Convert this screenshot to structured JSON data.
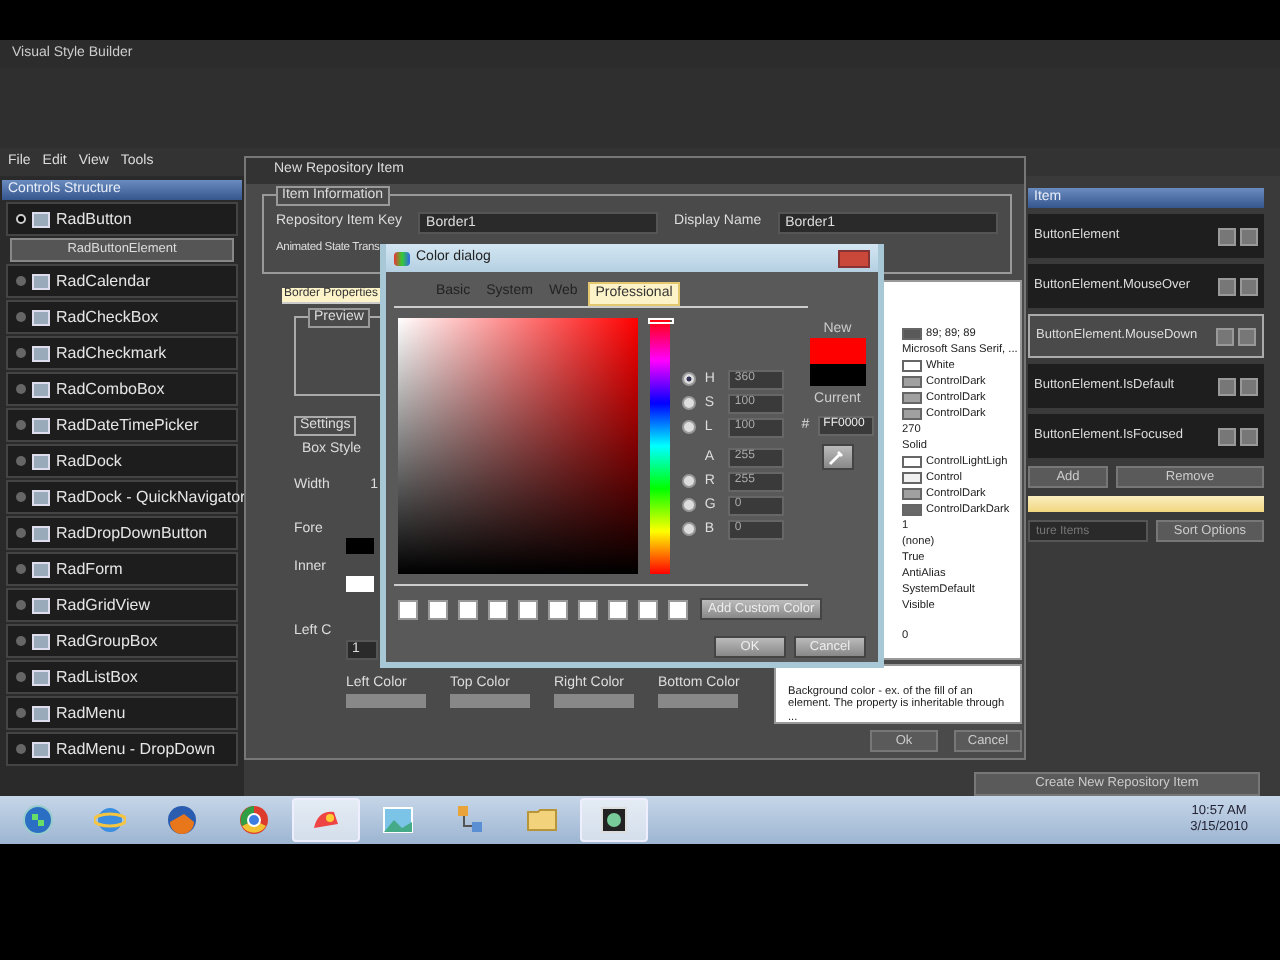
{
  "app": {
    "title": "Visual Style Builder",
    "menu": [
      "File",
      "Edit",
      "View",
      "Tools"
    ]
  },
  "controls_structure": {
    "title": "Controls Structure",
    "items": [
      {
        "label": "RadButton",
        "expanded": true,
        "children": [
          {
            "label": "RadButtonElement",
            "selected": true
          }
        ]
      },
      {
        "label": "RadCalendar",
        "expanded": false
      },
      {
        "label": "RadCheckBox",
        "expanded": false
      },
      {
        "label": "RadCheckmark",
        "expanded": false
      },
      {
        "label": "RadComboBox",
        "expanded": false
      },
      {
        "label": "RadDateTimePicker",
        "expanded": false
      },
      {
        "label": "RadDock",
        "expanded": false
      },
      {
        "label": "RadDock - QuickNavigator",
        "expanded": false
      },
      {
        "label": "RadDropDownButton",
        "expanded": false
      },
      {
        "label": "RadForm",
        "expanded": false
      },
      {
        "label": "RadGridView",
        "expanded": false
      },
      {
        "label": "RadGroupBox",
        "expanded": false
      },
      {
        "label": "RadListBox",
        "expanded": false
      },
      {
        "label": "RadMenu",
        "expanded": false
      },
      {
        "label": "RadMenu - DropDown",
        "expanded": false
      }
    ]
  },
  "states_panel": {
    "title": "Item",
    "items": [
      {
        "label": "ButtonElement",
        "selected": false
      },
      {
        "label": "ButtonElement.MouseOver",
        "selected": false
      },
      {
        "label": "ButtonElement.MouseDown",
        "selected": true
      },
      {
        "label": "ButtonElement.IsDefault",
        "selected": false
      },
      {
        "label": "ButtonElement.IsFocused",
        "selected": false
      }
    ],
    "add_button": "Add",
    "remove_button": "Remove",
    "filter": {
      "placeholder": "ture Items"
    },
    "sort_button": "Sort Options"
  },
  "create_button": "Create New Repository Item",
  "repository_dialog": {
    "title": "New Repository Item",
    "group": "Item Information",
    "key_label": "Repository Item Key",
    "key_value": "Border1",
    "name_label": "Display Name",
    "name_value": "Border1",
    "animated_label": "Animated State Trans",
    "tabs": [
      {
        "label": "Border Properties",
        "selected": true
      }
    ],
    "preview_label": "Preview",
    "settings_label": "Settings",
    "box_style_label": "Box Style",
    "width_label": "Width",
    "width_value": "1",
    "fore_label": "Fore",
    "inner_label": "Inner",
    "left_label": "Left C",
    "left_value": "1",
    "edge_colors": [
      "Left Color",
      "Top Color",
      "Right Color",
      "Bottom Color"
    ],
    "properties": [
      {
        "value": "89; 89; 89",
        "color": "#595959"
      },
      {
        "value": "Microsoft Sans Serif, ..."
      },
      {
        "value": "White",
        "color": "#ffffff"
      },
      {
        "value": "ControlDark",
        "color": "#a0a0a0"
      },
      {
        "value": "ControlDark",
        "color": "#a0a0a0"
      },
      {
        "value": "ControlDark",
        "color": "#a0a0a0"
      },
      {
        "value": "270"
      },
      {
        "value": "Solid"
      },
      {
        "value": "ControlLightLigh",
        "color": "#ffffff"
      },
      {
        "value": "Control",
        "color": "#f0f0f0"
      },
      {
        "value": "ControlDark",
        "color": "#a0a0a0"
      },
      {
        "value": "ControlDarkDark",
        "color": "#696969"
      },
      {
        "value": "1"
      },
      {
        "value": "(none)"
      },
      {
        "value": "True"
      },
      {
        "value": "AntiAlias"
      },
      {
        "value": "SystemDefault"
      },
      {
        "value": "Visible"
      },
      {
        "value": "0"
      }
    ],
    "description": "Background color - ex. of the fill of an element. The property is inheritable through ...",
    "buttons": [
      "Ok",
      "Cancel"
    ]
  },
  "color_dialog": {
    "title": "Color dialog",
    "tabs": [
      {
        "label": "Basic",
        "selected": false
      },
      {
        "label": "System",
        "selected": false
      },
      {
        "label": "Web",
        "selected": false
      },
      {
        "label": "Professional",
        "selected": true
      }
    ],
    "hsl": [
      {
        "label": "H",
        "value": "360",
        "selected": true
      },
      {
        "label": "S",
        "value": "100",
        "selected": false
      },
      {
        "label": "L",
        "value": "100",
        "selected": false
      }
    ],
    "alpha": {
      "label": "A",
      "value": "255"
    },
    "rgb": [
      {
        "label": "R",
        "value": "255",
        "selected": false
      },
      {
        "label": "G",
        "value": "0",
        "selected": false
      },
      {
        "label": "B",
        "value": "0",
        "selected": false
      }
    ],
    "hue_slider": {
      "level": 1
    },
    "new_label": "New",
    "current_label": "Current",
    "hex_label": "#",
    "hex_value": "FF0000",
    "add_custom_button": "Add Custom Color",
    "ok_button": "OK",
    "cancel_button": "Cancel"
  },
  "taskbar": {
    "apps": [
      {
        "kind": "orb",
        "selected": false
      },
      {
        "kind": "globe",
        "selected": false
      },
      {
        "kind": "fox",
        "selected": false
      },
      {
        "kind": "wheel",
        "selected": false
      },
      {
        "kind": "paint",
        "selected": true
      },
      {
        "kind": "picture",
        "selected": false
      },
      {
        "kind": "network",
        "selected": false
      },
      {
        "kind": "folder",
        "selected": false
      },
      {
        "kind": "app",
        "selected": true
      }
    ],
    "time": "10:57 AM",
    "date": "3/15/2010"
  }
}
